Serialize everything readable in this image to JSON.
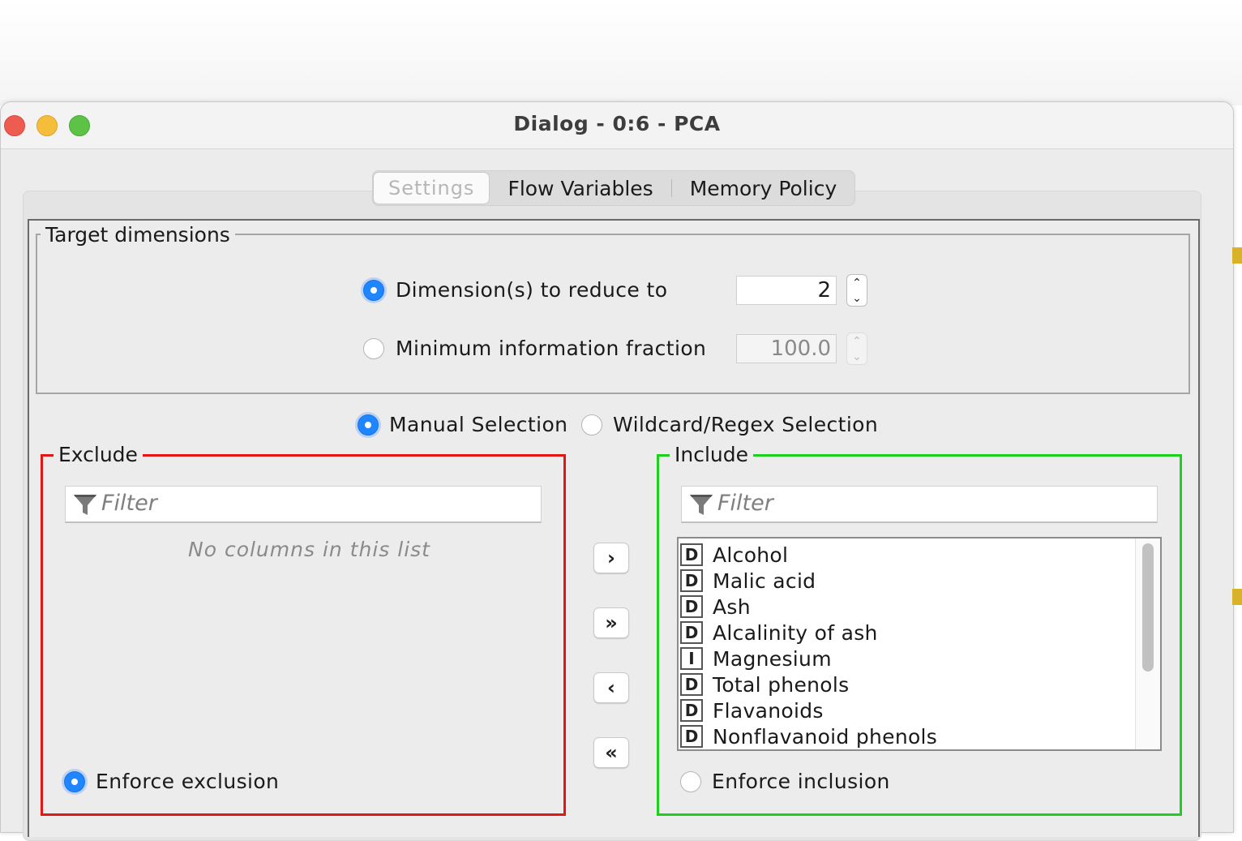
{
  "window": {
    "title": "Dialog - 0:6 - PCA"
  },
  "tabs": [
    {
      "label": "Settings",
      "active": true
    },
    {
      "label": "Flow Variables",
      "active": false
    },
    {
      "label": "Memory Policy",
      "active": false
    }
  ],
  "target_dimensions": {
    "group_label": "Target dimensions",
    "option_dimensions": {
      "label": "Dimension(s) to reduce to",
      "selected": true,
      "value": "2"
    },
    "option_fraction": {
      "label": "Minimum information fraction",
      "selected": false,
      "value": "100.0"
    }
  },
  "selection_mode": {
    "manual": {
      "label": "Manual Selection",
      "selected": true
    },
    "wildcard": {
      "label": "Wildcard/Regex Selection",
      "selected": false
    }
  },
  "exclude": {
    "label": "Exclude",
    "filter_placeholder": "Filter",
    "empty_message": "No columns in this list",
    "enforce_label": "Enforce exclusion",
    "enforce_selected": true,
    "frame_color": "#e31616"
  },
  "include": {
    "label": "Include",
    "filter_placeholder": "Filter",
    "enforce_label": "Enforce inclusion",
    "enforce_selected": false,
    "frame_color": "#1fcf1f",
    "items": [
      {
        "type": "D",
        "label": "Alcohol"
      },
      {
        "type": "D",
        "label": "Malic acid"
      },
      {
        "type": "D",
        "label": "Ash"
      },
      {
        "type": "D",
        "label": "Alcalinity of ash"
      },
      {
        "type": "I",
        "label": "Magnesium"
      },
      {
        "type": "D",
        "label": "Total phenols"
      },
      {
        "type": "D",
        "label": "Flavanoids"
      },
      {
        "type": "D",
        "label": "Nonflavanoid phenols"
      }
    ]
  },
  "move_buttons": {
    "add": "›",
    "add_all": "»",
    "remove": "‹",
    "remove_all": "«"
  },
  "icons": {
    "filter": "funnel-icon",
    "radio_on_color": "#1f86ff"
  }
}
